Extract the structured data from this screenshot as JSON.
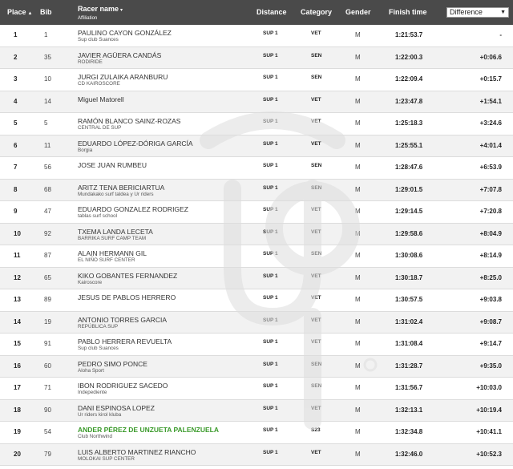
{
  "header": {
    "place": "Place",
    "bib": "Bib",
    "racer_name": "Racer name",
    "affiliation": "Affiliation",
    "distance": "Distance",
    "category": "Category",
    "gender": "Gender",
    "finish_time": "Finish time",
    "difference_select": "Difference"
  },
  "results": [
    {
      "place": "1",
      "bib": "1",
      "name": "PAULINO CAYON GONZÁLEZ",
      "affiliation": "Sup club Suances",
      "distance": "SUP 1",
      "category": "VET",
      "gender": "M",
      "time": "1:21:53.7",
      "diff": "-"
    },
    {
      "place": "2",
      "bib": "35",
      "name": "JAVIER AGÜERA CANDÁS",
      "affiliation": "RODIRIDE",
      "distance": "SUP 1",
      "category": "SEN",
      "gender": "M",
      "time": "1:22:00.3",
      "diff": "+0:06.6"
    },
    {
      "place": "3",
      "bib": "10",
      "name": "JURGI ZULAIKA ARANBURU",
      "affiliation": "CD KAIROSCORE",
      "distance": "SUP 1",
      "category": "SEN",
      "gender": "M",
      "time": "1:22:09.4",
      "diff": "+0:15.7"
    },
    {
      "place": "4",
      "bib": "14",
      "name": "Miguel Matorell",
      "affiliation": "",
      "distance": "SUP 1",
      "category": "VET",
      "gender": "M",
      "time": "1:23:47.8",
      "diff": "+1:54.1"
    },
    {
      "place": "5",
      "bib": "5",
      "name": "RAMÓN BLANCO SAINZ-ROZAS",
      "affiliation": "CENTRAL DE SUP",
      "distance": "SUP 1",
      "category": "VET",
      "gender": "M",
      "time": "1:25:18.3",
      "diff": "+3:24.6"
    },
    {
      "place": "6",
      "bib": "11",
      "name": "EDUARDO LÓPEZ-DÓRIGA GARCÍA",
      "affiliation": "Borgia",
      "distance": "SUP 1",
      "category": "VET",
      "gender": "M",
      "time": "1:25:55.1",
      "diff": "+4:01.4"
    },
    {
      "place": "7",
      "bib": "56",
      "name": "JOSE JUAN RUMBEU",
      "affiliation": "",
      "distance": "SUP 1",
      "category": "SEN",
      "gender": "M",
      "time": "1:28:47.6",
      "diff": "+6:53.9"
    },
    {
      "place": "8",
      "bib": "68",
      "name": "ARITZ TENA BERICIARTUA",
      "affiliation": "Mundakako surf taldea y Ur riders",
      "distance": "SUP 1",
      "category": "SEN",
      "gender": "M",
      "time": "1:29:01.5",
      "diff": "+7:07.8"
    },
    {
      "place": "9",
      "bib": "47",
      "name": "EDUARDO GONZALEZ RODRIGEZ",
      "affiliation": "tablas surf school",
      "distance": "SUP 1",
      "category": "VET",
      "gender": "M",
      "time": "1:29:14.5",
      "diff": "+7:20.8"
    },
    {
      "place": "10",
      "bib": "92",
      "name": "TXEMA LANDA LECETA",
      "affiliation": "BARRIKA SURF CAMP TEAM",
      "distance": "SUP 1",
      "category": "VET",
      "gender": "M",
      "time": "1:29:58.6",
      "diff": "+8:04.9"
    },
    {
      "place": "11",
      "bib": "87",
      "name": "ALAIN HERMANN GIL",
      "affiliation": "EL NIÑO SURF CENTER",
      "distance": "SUP 1",
      "category": "SEN",
      "gender": "M",
      "time": "1:30:08.6",
      "diff": "+8:14.9"
    },
    {
      "place": "12",
      "bib": "65",
      "name": "KIKO GOBANTES FERNANDEZ",
      "affiliation": "Kairoscore",
      "distance": "SUP 1",
      "category": "VET",
      "gender": "M",
      "time": "1:30:18.7",
      "diff": "+8:25.0"
    },
    {
      "place": "13",
      "bib": "89",
      "name": "JESUS DE PABLOS HERRERO",
      "affiliation": "",
      "distance": "SUP 1",
      "category": "VET",
      "gender": "M",
      "time": "1:30:57.5",
      "diff": "+9:03.8"
    },
    {
      "place": "14",
      "bib": "19",
      "name": "ANTONIO TORRES GARCIA",
      "affiliation": "REPÚBLICA SUP",
      "distance": "SUP 1",
      "category": "VET",
      "gender": "M",
      "time": "1:31:02.4",
      "diff": "+9:08.7"
    },
    {
      "place": "15",
      "bib": "91",
      "name": "PABLO HERRERA REVUELTA",
      "affiliation": "Sup club Suances",
      "distance": "SUP 1",
      "category": "VET",
      "gender": "M",
      "time": "1:31:08.4",
      "diff": "+9:14.7"
    },
    {
      "place": "16",
      "bib": "60",
      "name": "PEDRO SIMO PONCE",
      "affiliation": "Aloha Sport",
      "distance": "SUP 1",
      "category": "SEN",
      "gender": "M",
      "time": "1:31:28.7",
      "diff": "+9:35.0"
    },
    {
      "place": "17",
      "bib": "71",
      "name": "IBON RODRIGUEZ SACEDO",
      "affiliation": "Indepediente",
      "distance": "SUP 1",
      "category": "SEN",
      "gender": "M",
      "time": "1:31:56.7",
      "diff": "+10:03.0"
    },
    {
      "place": "18",
      "bib": "90",
      "name": "DANI ESPINOSA LOPEZ",
      "affiliation": "Ur riders kirol kluba",
      "distance": "SUP 1",
      "category": "VET",
      "gender": "M",
      "time": "1:32:13.1",
      "diff": "+10:19.4"
    },
    {
      "place": "19",
      "bib": "54",
      "name": "ANDER PÉREZ DE UNZUETA PALENZUELA",
      "affiliation": "Club Northwind",
      "distance": "SUP 1",
      "category": "S23",
      "gender": "M",
      "time": "1:32:34.8",
      "diff": "+10:41.1",
      "highlight": true
    },
    {
      "place": "20",
      "bib": "79",
      "name": "LUIS ALBERTO MARTINEZ RIANCHO",
      "affiliation": "MOLOKAI SUP CENTER",
      "distance": "SUP 1",
      "category": "VET",
      "gender": "M",
      "time": "1:32:46.0",
      "diff": "+10:52.3"
    }
  ],
  "colors": {
    "header_bg": "#4a4a4a",
    "row_alt_bg": "#f2f2f2",
    "highlight_name": "#3a9a2a",
    "watermark": "#e9e9e9"
  },
  "watermark_icon": "up-logo-watermark"
}
